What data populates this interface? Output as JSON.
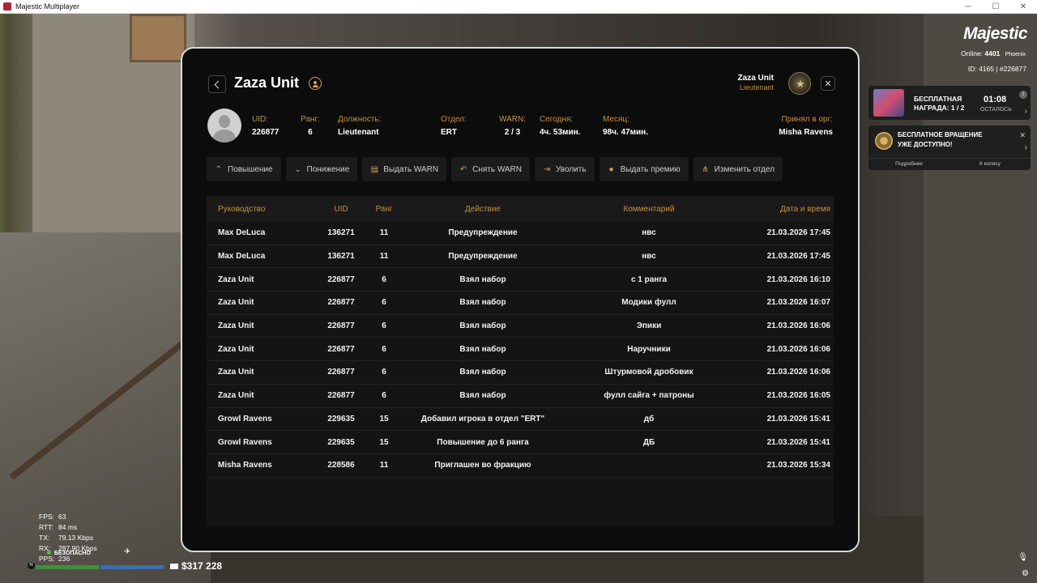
{
  "window": {
    "title": "Majestic Multiplayer",
    "controls": [
      "─",
      "☐",
      "✕"
    ]
  },
  "panel": {
    "title": "Zaza Unit",
    "user": {
      "name": "Zaza Unit",
      "rank": "Lieutenant"
    },
    "close": "✕",
    "info": [
      {
        "label": "UID:",
        "value": "226877"
      },
      {
        "label": "Ранг:",
        "value": "6"
      },
      {
        "label": "Должность:",
        "value": "Lieutenant"
      },
      {
        "label": "Отдел:",
        "value": "ERT"
      },
      {
        "label": "WARN:",
        "value": "2 / 3"
      },
      {
        "label": "Сегодня:",
        "value": "4ч. 53мин."
      },
      {
        "label": "Месяц:",
        "value": "98ч. 47мин."
      },
      {
        "label": "Принял в орг:",
        "value": "Misha Ravens"
      }
    ],
    "actions": [
      {
        "icon": "chevron-up-icon",
        "glyph": "⌃",
        "label": "Повышение"
      },
      {
        "icon": "chevron-down-icon",
        "glyph": "⌄",
        "label": "Понижение"
      },
      {
        "icon": "document-icon",
        "glyph": "▤",
        "label": "Выдать WARN"
      },
      {
        "icon": "undo-icon",
        "glyph": "↶",
        "label": "Снять WARN"
      },
      {
        "icon": "exit-icon",
        "glyph": "⇥",
        "label": "Уволить"
      },
      {
        "icon": "coin-icon",
        "glyph": "●",
        "label": "Выдать премию"
      },
      {
        "icon": "hierarchy-icon",
        "glyph": "⋔",
        "label": "Изменить отдел"
      }
    ],
    "table": {
      "headers": [
        "Руководство",
        "UID",
        "Ранг",
        "Действие",
        "Комментарий",
        "Дата и время"
      ],
      "rows": [
        [
          "Max DeLuca",
          "136271",
          "11",
          "Предупреждение",
          "нвс",
          "21.03.2026 17:45"
        ],
        [
          "Max DeLuca",
          "136271",
          "11",
          "Предупреждение",
          "нвс",
          "21.03.2026 17:45"
        ],
        [
          "Zaza Unit",
          "226877",
          "6",
          "Взял набор",
          "с 1 ранга",
          "21.03.2026 16:10"
        ],
        [
          "Zaza Unit",
          "226877",
          "6",
          "Взял набор",
          "Модики фулл",
          "21.03.2026 16:07"
        ],
        [
          "Zaza Unit",
          "226877",
          "6",
          "Взял набор",
          "Эпики",
          "21.03.2026 16:06"
        ],
        [
          "Zaza Unit",
          "226877",
          "6",
          "Взял набор",
          "Наручники",
          "21.03.2026 16:06"
        ],
        [
          "Zaza Unit",
          "226877",
          "6",
          "Взял набор",
          "Штурмовой дробовик",
          "21.03.2026 16:06"
        ],
        [
          "Zaza Unit",
          "226877",
          "6",
          "Взял набор",
          "фулл сайга + патроны",
          "21.03.2026 16:05"
        ],
        [
          "Growl Ravens",
          "229635",
          "15",
          "Добавил игрока в отдел \"ERT\"",
          "дб",
          "21.03.2026 15:41"
        ],
        [
          "Growl Ravens",
          "229635",
          "15",
          "Повышение до 6 ранга",
          "ДБ",
          "21.03.2026 15:41"
        ],
        [
          "Misha Ravens",
          "228586",
          "11",
          "Приглашен во фракцию",
          "",
          "21.03.2026 15:34"
        ]
      ]
    }
  },
  "hud": {
    "brand": "Majestic",
    "online_label": "Online:",
    "online_value": "4401",
    "server": "Phoenix",
    "id_line": "ID: 4165 | #226877",
    "reward": {
      "title_line1": "БЕСПЛАТНАЯ",
      "title_line2": "НАГРАДА: 1 / 2",
      "time": "01:08",
      "left": "ОСТАЛОСЬ",
      "info": "i",
      "arrow": "›"
    },
    "spin": {
      "line1": "БЕСПЛАТНОЕ ВРАЩЕНИЕ",
      "line2": "УЖЕ ДОСТУПНО!",
      "close": "✕",
      "more": "Подробнее",
      "to_wheel": "К колесу",
      "arrow": "›"
    },
    "net": [
      {
        "k": "FPS:",
        "v": "63"
      },
      {
        "k": "RTT:",
        "v": "84 ms"
      },
      {
        "k": "TX:",
        "v": "79.13 Kbps"
      },
      {
        "k": "RX:",
        "v": "287.90 Kbps"
      },
      {
        "k": "PPS:",
        "v": "236"
      }
    ],
    "zone": "БЕЗОПАСНО",
    "minimap_n": "N",
    "money": "$317 228",
    "health_colors": [
      "#3f8f3f",
      "#3a6fb0",
      "#333333"
    ]
  }
}
